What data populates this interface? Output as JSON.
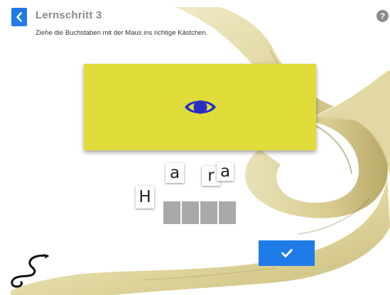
{
  "header": {
    "title": "Lernschritt 3",
    "instruction": "Ziehe die Buchstaben mit der Maus ins richtige Kästchen.",
    "help_label": "?"
  },
  "word_card": {
    "image_icon": "eye-icon",
    "card_color": "#e0dd3b",
    "icon_color": "#2a2fc4"
  },
  "letter_tiles": [
    {
      "letter": "a"
    },
    {
      "letter": "r"
    },
    {
      "letter": "a"
    },
    {
      "letter": "H"
    }
  ],
  "answer_slots": {
    "count": 4,
    "slots": [
      "",
      "",
      "",
      ""
    ]
  },
  "buttons": {
    "back_icon": "chevron-left-icon",
    "check_icon": "checkmark-icon"
  },
  "colors": {
    "accent": "#1f7be8",
    "slot": "#a9a9a9",
    "title_gray": "#8a8a8a"
  },
  "decor": {
    "logo_icon": "snake-logo-icon"
  }
}
